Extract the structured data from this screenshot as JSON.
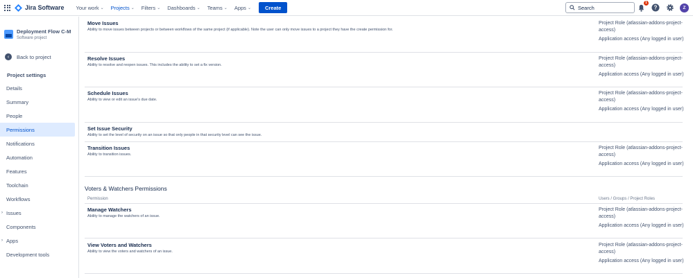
{
  "topnav": {
    "logo_text": "Jira Software",
    "items": [
      {
        "label": "Your work",
        "chevron": true
      },
      {
        "label": "Projects",
        "chevron": true
      },
      {
        "label": "Filters",
        "chevron": true
      },
      {
        "label": "Dashboards",
        "chevron": true
      },
      {
        "label": "Teams",
        "chevron": true
      },
      {
        "label": "Apps",
        "chevron": true
      }
    ],
    "create_label": "Create",
    "search_placeholder": "Search",
    "notification_count": "1",
    "avatar_initial": "Z"
  },
  "sidebar": {
    "project_name": "Deployment Flow C-M",
    "project_type": "Software project",
    "back_label": "Back to project",
    "section_title": "Project settings",
    "items": [
      {
        "label": "Details"
      },
      {
        "label": "Summary"
      },
      {
        "label": "People"
      },
      {
        "label": "Permissions",
        "active": true
      },
      {
        "label": "Notifications"
      },
      {
        "label": "Automation"
      },
      {
        "label": "Features"
      },
      {
        "label": "Toolchain"
      },
      {
        "label": "Workflows"
      },
      {
        "label": "Issues",
        "expandable": true
      },
      {
        "label": "Components"
      },
      {
        "label": "Apps",
        "expandable": true
      },
      {
        "label": "Development tools"
      }
    ]
  },
  "main": {
    "issue_permissions": [
      {
        "name": "Move Issues",
        "description": "Ability to move issues between projects or between workflows of the same project (if applicable). Note the user can only move issues to a project they have the create permission for.",
        "grants": [
          "Project Role (atlassian-addons-project-access)",
          "Application access (Any logged in user)"
        ]
      },
      {
        "name": "Resolve Issues",
        "description": "Ability to resolve and reopen issues. This includes the ability to set a fix version.",
        "grants": [
          "Project Role (atlassian-addons-project-access)",
          "Application access (Any logged in user)"
        ]
      },
      {
        "name": "Schedule Issues",
        "description": "Ability to view or edit an issue's due date.",
        "grants": [
          "Project Role (atlassian-addons-project-access)",
          "Application access (Any logged in user)"
        ]
      },
      {
        "name": "Set Issue Security",
        "description": "Ability to set the level of security on an issue so that only people in that security level can see the issue.",
        "grants": []
      },
      {
        "name": "Transition Issues",
        "description": "Ability to transition issues.",
        "grants": [
          "Project Role (atlassian-addons-project-access)",
          "Application access (Any logged in user)"
        ]
      }
    ],
    "voters_group": {
      "title": "Voters & Watchers Permissions",
      "col_permission": "Permission",
      "col_grants": "Users / Groups / Project Roles",
      "permissions": [
        {
          "name": "Manage Watchers",
          "description": "Ability to manage the watchers of an issue.",
          "grants": [
            "Project Role (atlassian-addons-project-access)",
            "Application access (Any logged in user)"
          ]
        },
        {
          "name": "View Voters and Watchers",
          "description": "Ability to view the voters and watchers of an issue.",
          "grants": [
            "Project Role (atlassian-addons-project-access)",
            "Application access (Any logged in user)"
          ]
        }
      ]
    }
  }
}
